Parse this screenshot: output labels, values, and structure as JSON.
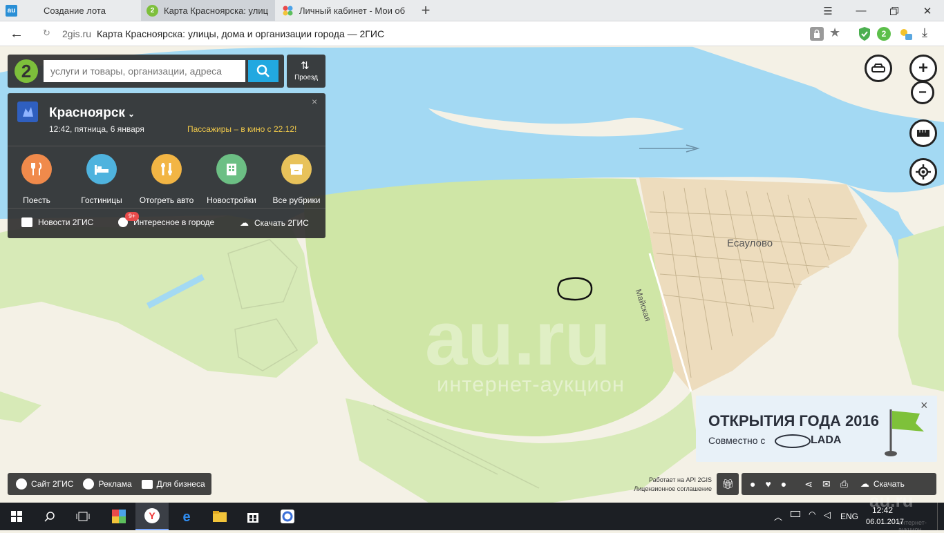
{
  "browser": {
    "tabs": [
      {
        "label": "Создание лота",
        "favicon": "au",
        "active": false
      },
      {
        "label": "Карта Красноярска: улиц",
        "favicon": "2",
        "active": true
      },
      {
        "label": "Личный кабинет - Мои об",
        "favicon": "",
        "active": false
      }
    ],
    "new_tab_icon": "plus-icon",
    "url_domain": "2gis.ru",
    "page_title": "Карта Красноярска: улицы, дома и организации города — 2ГИС",
    "ext_badge": "2"
  },
  "search": {
    "placeholder": "услуги и товары, организации, адреса",
    "route_label": "Проезд"
  },
  "city_panel": {
    "city": "Красноярск",
    "datetime": "12:42, пятница, 6 января",
    "promo": "Пассажиры – в кино с 22.12!",
    "categories": [
      {
        "label": "Поесть",
        "icon": "fork-knife-icon",
        "color": "#f08a4b"
      },
      {
        "label": "Гостиницы",
        "icon": "bed-icon",
        "color": "#4fb3de"
      },
      {
        "label": "Отогреть авто",
        "icon": "wrench-icon",
        "color": "#f2b544"
      },
      {
        "label": "Новостройки",
        "icon": "building-icon",
        "color": "#6cbf84"
      },
      {
        "label": "Все рубрики",
        "icon": "box-icon",
        "color": "#e8c25a"
      }
    ],
    "links": {
      "news": "Новости 2ГИС",
      "interesting": "Интересное в городе",
      "interesting_badge": "9+",
      "download": "Скачать 2ГИС"
    }
  },
  "map": {
    "place_label": "Есаулово",
    "street_label": "Майская",
    "watermark_main": "au.ru",
    "watermark_sub": "интернет-аукцион"
  },
  "ad": {
    "title": "ОТКРЫТИЯ ГОДА 2016",
    "subtitle": "Совместно с",
    "brand": "LADA"
  },
  "footer": {
    "site": "Сайт 2ГИС",
    "ads": "Реклама",
    "business": "Для бизнеса",
    "api_note": "Работает на API 2GIS",
    "license": "Лицензионное соглашение",
    "download": "Скачать",
    "corner_watermark": "au.ru",
    "corner_watermark_sub": "интернет-аукцион"
  },
  "taskbar": {
    "lang": "ENG",
    "time": "12:42",
    "date": "06.01.2017"
  },
  "colors": {
    "river": "#a3d9f3",
    "park": "#cfe6a6",
    "land": "#f4f1e6",
    "village": "#eddcbd",
    "accent": "#22a8e0"
  }
}
